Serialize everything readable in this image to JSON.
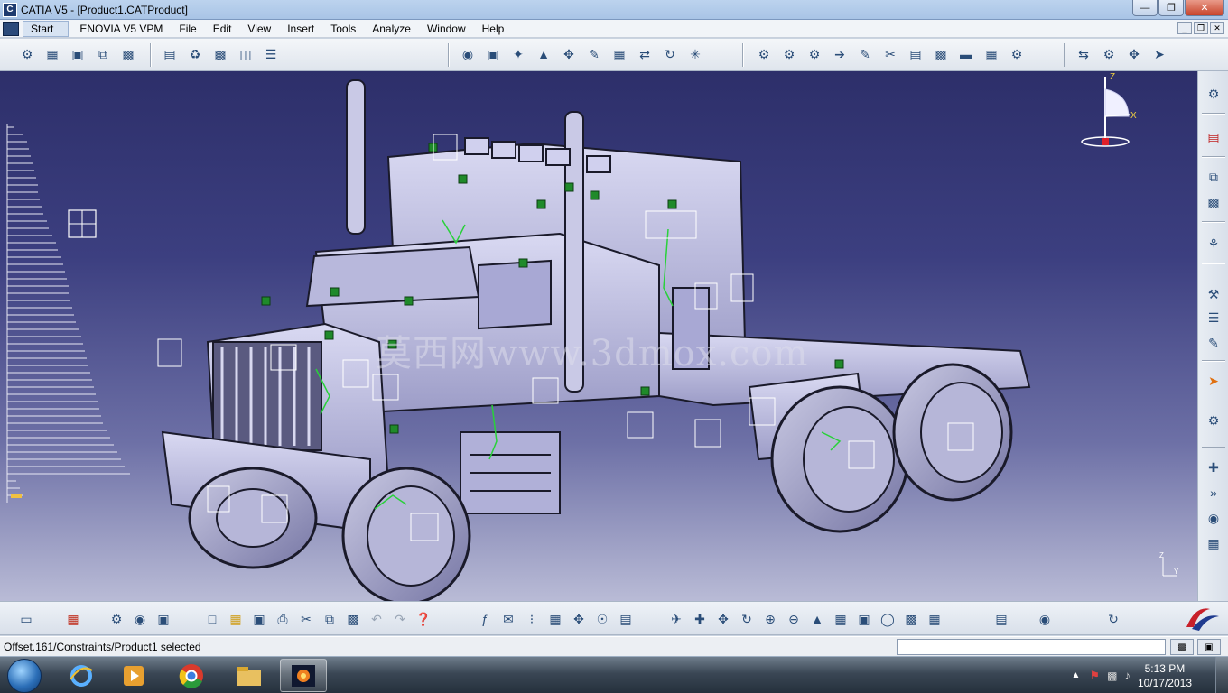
{
  "window": {
    "title": "CATIA V5 - [Product1.CATProduct]"
  },
  "menu": {
    "items": [
      "Start",
      "ENOVIA V5 VPM",
      "File",
      "Edit",
      "View",
      "Insert",
      "Tools",
      "Analyze",
      "Window",
      "Help"
    ]
  },
  "viewport": {
    "watermark": "莫西网www.3dmox.com",
    "compass_labels": {
      "z": "Z",
      "x": "X",
      "y": "Y"
    }
  },
  "status": {
    "message": "Offset.161/Constraints/Product1 selected"
  },
  "taskbar": {
    "time": "5:13 PM",
    "date": "10/17/2013",
    "apps": [
      "internet-explorer",
      "media-player",
      "chrome",
      "file-explorer",
      "catia"
    ]
  },
  "icons": {
    "top_toolbar": [
      "new-component-icon",
      "new-product-icon",
      "new-part-icon",
      "existing-component-icon",
      "replace-component-icon",
      "graph-tree-icon",
      "generate-numbering-icon",
      "selective-load-icon",
      "manage-representations-icon",
      "multi-instantiation-icon",
      "sphere-icon",
      "cube-icon",
      "explode-icon",
      "snap-icon",
      "manipulation-icon",
      "stop-manipulation-icon",
      "clash-icon",
      "smart-move-icon",
      "fix-together-icon",
      "coincidence-icon",
      "contact-icon",
      "offset-icon",
      "angle-icon",
      "fix-icon",
      "fix-together-icon",
      "quick-constraint-icon",
      "flexible-icon",
      "change-constraint-icon",
      "reuse-pattern-icon",
      "update-icon",
      "sectioning-icon",
      "distance-icon",
      "measure-icon"
    ],
    "right_toolbar": [
      "gear-icon",
      "pdf-icon",
      "copy-icon",
      "paste-icon",
      "scene-icon",
      "tools-icon",
      "tree-icon",
      "pencil-icon",
      "pointer-icon",
      "catalog-icon",
      "annotation-icon",
      "forward-icon",
      "view-icon",
      "layer-icon"
    ],
    "bottom_toolbar": [
      "eraser-icon",
      "grid-icon",
      "assembly-icon",
      "explode-view-icon",
      "color-icon",
      "new-icon",
      "open-icon",
      "save-icon",
      "print-icon",
      "cut-icon",
      "copy-icon",
      "paste-icon",
      "undo-icon",
      "redo-icon",
      "whats-this-icon",
      "formula-icon",
      "comment-icon",
      "knowledge-icon",
      "table-icon",
      "compass-icon",
      "lock-icon",
      "catalog-icon",
      "fly-icon",
      "fit-all-icon",
      "pan-icon",
      "rotate-icon",
      "zoom-in-icon",
      "zoom-out-icon",
      "normal-view-icon",
      "iso-view-icon",
      "render-style-icon",
      "hide-show-icon",
      "swap-visible-icon",
      "apply-material-icon",
      "catalog-browser-icon",
      "camera-icon",
      "update-all-icon"
    ]
  },
  "colors": {
    "accent": "#2b4a7a",
    "viewport_top": "#2d2f6a",
    "viewport_bottom": "#b9bbd6",
    "selection_green": "#29d13a"
  }
}
